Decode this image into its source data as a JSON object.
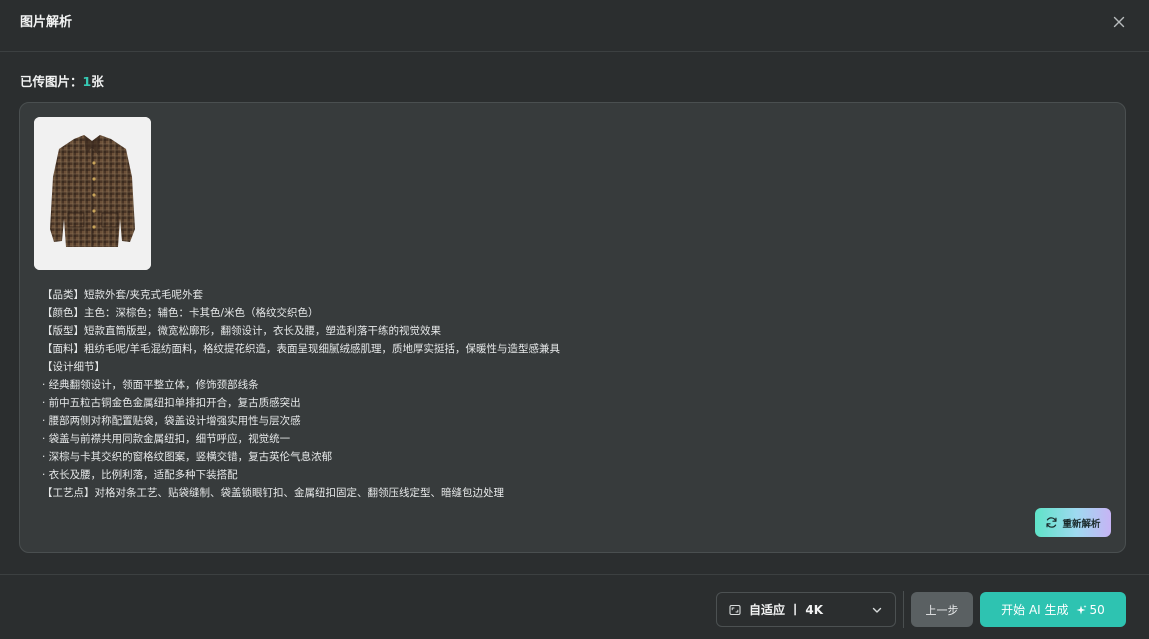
{
  "dialog": {
    "title": "图片解析"
  },
  "upload": {
    "label": "已传图片：",
    "count": "1",
    "unit": "张"
  },
  "analysis": {
    "lines": [
      "【品类】短款外套/夹克式毛呢外套",
      "【颜色】主色：深棕色；辅色：卡其色/米色（格纹交织色）",
      "【版型】短款直筒版型，微宽松廓形，翻领设计，衣长及腰，塑造利落干练的视觉效果",
      "【面料】粗纺毛呢/羊毛混纺面料，格纹提花织造，表面呈现细腻绒感肌理，质地厚实挺括，保暖性与造型感兼具",
      "【设计细节】",
      "· 经典翻领设计，领面平整立体，修饰颈部线条",
      "· 前中五粒古铜金色金属纽扣单排扣开合，复古质感突出",
      "· 腰部两侧对称配置贴袋，袋盖设计增强实用性与层次感",
      "· 袋盖与前襟共用同款金属纽扣，细节呼应，视觉统一",
      "· 深棕与卡其交织的窗格纹图案，竖横交错，复古英伦气息浓郁",
      "· 衣长及腰，比例利落，适配多种下装搭配",
      "【工艺点】对格对条工艺、贴袋缝制、袋盖锁眼钉扣、金属纽扣固定、翻领压线定型、暗缝包边处理"
    ],
    "reparse_label": "重新解析"
  },
  "footer": {
    "ratio_value": "自适应 丨 4K",
    "prev_label": "上一步",
    "generate_label": "开始 AI 生成",
    "generate_cost": "50"
  },
  "colors": {
    "accent": "#2ec3b1",
    "count": "#36c9b4",
    "background": "#2b2e2f",
    "panel": "#373b3c"
  }
}
